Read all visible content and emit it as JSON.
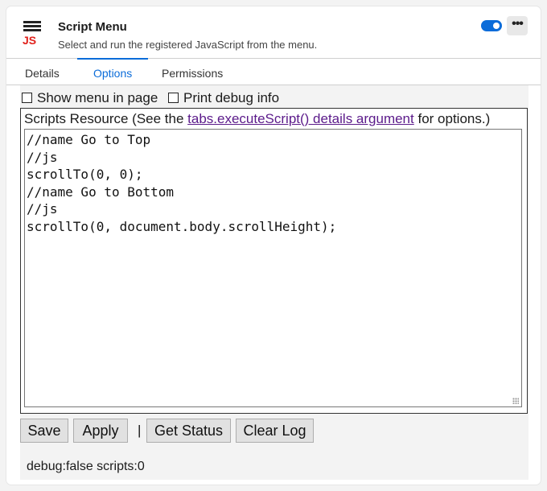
{
  "header": {
    "title": "Script Menu",
    "subtitle": "Select and run the registered JavaScript from the menu.",
    "icon_text": "JS",
    "more_label": "•••",
    "toggle_on": true,
    "accent": "#0b6cd9"
  },
  "tabs": [
    {
      "label": "Details"
    },
    {
      "label": "Options",
      "active": true
    },
    {
      "label": "Permissions"
    }
  ],
  "options": {
    "show_menu_label": "Show menu in page",
    "show_menu_checked": false,
    "print_debug_label": "Print debug info",
    "print_debug_checked": false
  },
  "scripts": {
    "legend_prefix": "Scripts Resource (See the ",
    "legend_link": "tabs.executeScript() details argument",
    "legend_suffix": " for options.)",
    "content": "//name Go to Top\n//js\nscrollTo(0, 0);\n//name Go to Bottom\n//js\nscrollTo(0, document.body.scrollHeight);"
  },
  "buttons": {
    "save": "Save",
    "apply": "Apply",
    "separator": "|",
    "get_status": "Get Status",
    "clear_log": "Clear Log"
  },
  "status_text": "debug:false scripts:0"
}
